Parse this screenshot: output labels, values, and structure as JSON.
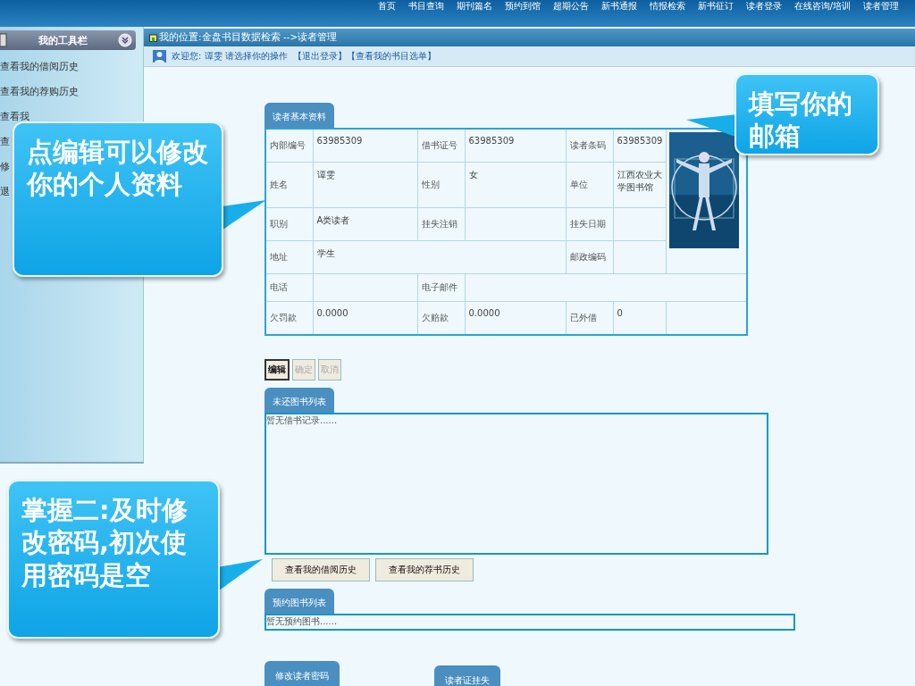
{
  "top_nav": [
    "首页",
    "书目查询",
    "期刊篇名",
    "预约到馆",
    "超期公告",
    "新书通报",
    "情报检索",
    "新书征订",
    "读者登录",
    "在线咨询/培训",
    "读者管理"
  ],
  "sidebar": {
    "title": "我的工具栏",
    "items": [
      "查看我的借阅历史",
      "查看我的荐购历史",
      "查看我",
      "查",
      "修",
      "退"
    ]
  },
  "breadcrumb": "我的位置:金盘书目数据检索 -->读者管理",
  "welcome": {
    "text": "欢迎您: 谭雯 请选择你的操作",
    "links": [
      "【退出登录】",
      "【查看我的书目选单】"
    ]
  },
  "reader_info": {
    "tab": "读者基本资料",
    "rows": [
      [
        {
          "kind": "label",
          "text": "内部编号"
        },
        {
          "kind": "value",
          "text": "63985309"
        },
        {
          "kind": "label",
          "text": "借书证号"
        },
        {
          "kind": "value",
          "text": "63985309"
        },
        {
          "kind": "label",
          "text": "读者条码"
        },
        {
          "kind": "value",
          "text": "63985309"
        },
        {
          "kind": "picture",
          "rowspan": 4
        }
      ],
      [
        {
          "kind": "label",
          "text": "姓名"
        },
        {
          "kind": "value",
          "text": "谭雯"
        },
        {
          "kind": "label",
          "text": "性别"
        },
        {
          "kind": "value",
          "text": "女"
        },
        {
          "kind": "label",
          "text": "单位"
        },
        {
          "kind": "value",
          "text": "江西农业大学图书馆"
        }
      ],
      [
        {
          "kind": "label",
          "text": "职别"
        },
        {
          "kind": "value",
          "text": "A类读者"
        },
        {
          "kind": "label",
          "text": "挂失注销"
        },
        {
          "kind": "value"
        },
        {
          "kind": "label",
          "text": "挂失日期"
        },
        {
          "kind": "value"
        }
      ],
      [
        {
          "kind": "label",
          "text": "地址"
        },
        {
          "kind": "value",
          "text": "学生",
          "colspan": 3
        },
        {
          "kind": "label",
          "text": "邮政编码"
        },
        {
          "kind": "value"
        }
      ],
      [
        {
          "kind": "label",
          "text": "电话"
        },
        {
          "kind": "value"
        },
        {
          "kind": "label",
          "text": "电子邮件"
        },
        {
          "kind": "value",
          "colspan": 4
        }
      ],
      [
        {
          "kind": "label",
          "text": "欠罚款"
        },
        {
          "kind": "value",
          "text": "0.0000"
        },
        {
          "kind": "label",
          "text": "欠赔款"
        },
        {
          "kind": "value",
          "text": "0.0000"
        },
        {
          "kind": "label",
          "text": "已外借"
        },
        {
          "kind": "value",
          "text": "0"
        },
        {
          "kind": "value"
        }
      ]
    ]
  },
  "edit_buttons": [
    {
      "label": "编辑",
      "disabled": false
    },
    {
      "label": "确定",
      "disabled": true
    },
    {
      "label": "取消",
      "disabled": true
    }
  ],
  "loans": {
    "tab": "未还图书列表",
    "empty_text": "暂无借书记录......"
  },
  "history_buttons": [
    "查看我的借阅历史",
    "查看我的荐书历史"
  ],
  "reservations": {
    "tab": "预约图书列表",
    "empty_text": "暂无预约图书......"
  },
  "bottom_tabs": [
    "修改读者密码",
    "读者证挂失"
  ],
  "callouts": [
    {
      "text": "点编辑可以修改你的个人资料"
    },
    {
      "text": "填写你的邮箱"
    },
    {
      "text": "掌握二:及时修改密码,初次使用密码是空"
    }
  ]
}
